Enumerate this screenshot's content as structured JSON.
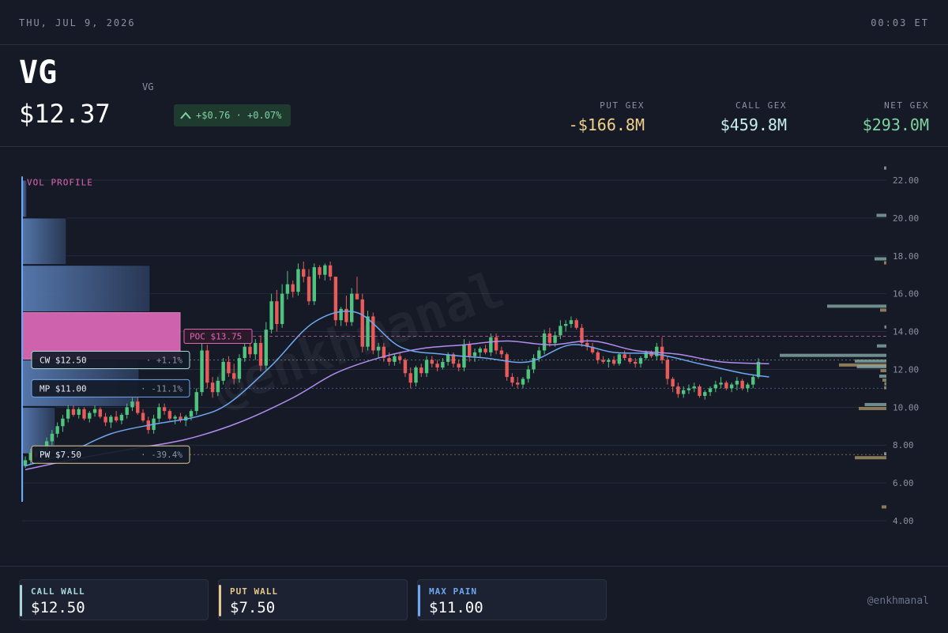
{
  "topbar": {
    "date": "THU, JUL 9, 2026",
    "time": "00:03 ET"
  },
  "header": {
    "ticker": "VG",
    "ticker_sub": "VG",
    "price": "$12.37",
    "change": "+$0.76 · +0.07%",
    "change_icon": "chevron-up-icon",
    "gex": [
      {
        "label": "PUT GEX",
        "value": "-$166.8M",
        "color": "#f0d08c"
      },
      {
        "label": "CALL GEX",
        "value": "$459.8M",
        "color": "#c8f0ee"
      },
      {
        "label": "NET GEX",
        "value": "$293.0M",
        "color": "#7fd3a0"
      }
    ]
  },
  "chart_data": {
    "type": "candlestick",
    "ylim": [
      4,
      22.8
    ],
    "yticks": [
      "22.00",
      "20.00",
      "18.00",
      "16.00",
      "14.00",
      "12.00",
      "10.00",
      "8.00",
      "6.00",
      "4.00"
    ],
    "watermark": "@enkhmanal",
    "vol_profile": {
      "label": "VOL PROFILE",
      "bins": [
        {
          "lo": 20.0,
          "hi": 22.0,
          "vol": 0.03
        },
        {
          "lo": 17.5,
          "hi": 20.0,
          "vol": 0.28
        },
        {
          "lo": 15.0,
          "hi": 17.5,
          "vol": 0.81
        },
        {
          "lo": 12.5,
          "hi": 15.0,
          "vol": 1.0
        },
        {
          "lo": 10.0,
          "hi": 12.5,
          "vol": 0.74
        },
        {
          "lo": 7.5,
          "hi": 10.0,
          "vol": 0.21
        },
        {
          "lo": 5.0,
          "hi": 7.5,
          "vol": 0.01
        }
      ]
    },
    "levels": [
      {
        "name": "POC",
        "label": "POC $13.75",
        "value": 13.75,
        "pct": "",
        "color": "#e066b4"
      },
      {
        "name": "CW",
        "label": "CW $12.50",
        "value": 12.5,
        "pct": "+1.1%",
        "color": "#a8d8d4"
      },
      {
        "name": "MP",
        "label": "MP $11.00",
        "value": 11.0,
        "pct": "-11.1%",
        "color": "#6ea8f0"
      },
      {
        "name": "PW",
        "label": "PW $7.50",
        "value": 7.5,
        "pct": "-39.4%",
        "color": "#e6c88c"
      }
    ],
    "candles": [
      [
        6.9,
        7.4,
        6.8,
        7.2
      ],
      [
        7.2,
        7.8,
        7.0,
        7.6
      ],
      [
        7.6,
        7.9,
        7.3,
        7.4
      ],
      [
        7.4,
        7.9,
        7.2,
        7.8
      ],
      [
        7.8,
        8.4,
        7.6,
        8.2
      ],
      [
        8.2,
        8.8,
        8.0,
        8.6
      ],
      [
        8.6,
        9.2,
        8.4,
        9.0
      ],
      [
        9.0,
        9.6,
        8.7,
        9.4
      ],
      [
        9.4,
        10.1,
        9.2,
        9.9
      ],
      [
        9.9,
        10.1,
        9.5,
        9.6
      ],
      [
        9.6,
        10.0,
        9.4,
        9.9
      ],
      [
        9.9,
        10.0,
        9.3,
        9.4
      ],
      [
        9.4,
        9.8,
        9.2,
        9.7
      ],
      [
        9.7,
        10.1,
        9.5,
        9.9
      ],
      [
        9.9,
        10.0,
        9.4,
        9.5
      ],
      [
        9.5,
        9.7,
        9.0,
        9.2
      ],
      [
        9.2,
        9.6,
        8.9,
        9.5
      ],
      [
        9.5,
        9.8,
        9.2,
        9.3
      ],
      [
        9.3,
        9.7,
        9.1,
        9.6
      ],
      [
        9.6,
        10.2,
        9.4,
        10.0
      ],
      [
        10.0,
        10.5,
        9.8,
        10.3
      ],
      [
        10.3,
        10.5,
        9.6,
        9.7
      ],
      [
        9.7,
        9.9,
        9.2,
        9.3
      ],
      [
        9.3,
        9.5,
        8.6,
        8.8
      ],
      [
        8.8,
        9.6,
        8.6,
        9.4
      ],
      [
        9.4,
        10.2,
        9.2,
        10.0
      ],
      [
        10.0,
        10.2,
        9.6,
        9.8
      ],
      [
        9.8,
        9.9,
        9.3,
        9.4
      ],
      [
        9.4,
        9.6,
        9.1,
        9.5
      ],
      [
        9.5,
        9.7,
        9.2,
        9.3
      ],
      [
        9.3,
        9.6,
        9.0,
        9.5
      ],
      [
        9.5,
        9.9,
        9.3,
        9.8
      ],
      [
        9.8,
        11.0,
        9.6,
        10.8
      ],
      [
        10.8,
        13.5,
        10.6,
        13.0
      ],
      [
        13.0,
        13.3,
        11.0,
        11.3
      ],
      [
        11.3,
        11.6,
        10.5,
        10.8
      ],
      [
        10.8,
        11.6,
        10.6,
        11.4
      ],
      [
        11.4,
        12.6,
        11.2,
        12.4
      ],
      [
        12.4,
        12.7,
        11.6,
        11.8
      ],
      [
        11.8,
        12.3,
        11.2,
        11.5
      ],
      [
        11.5,
        12.8,
        11.3,
        12.6
      ],
      [
        12.6,
        13.4,
        12.4,
        13.2
      ],
      [
        13.2,
        13.5,
        12.6,
        12.8
      ],
      [
        12.8,
        13.6,
        12.5,
        13.4
      ],
      [
        13.4,
        13.8,
        11.9,
        12.2
      ],
      [
        12.2,
        14.5,
        12.0,
        14.1
      ],
      [
        14.1,
        16.0,
        13.9,
        15.6
      ],
      [
        15.6,
        16.2,
        14.0,
        14.4
      ],
      [
        14.4,
        16.5,
        14.2,
        16.0
      ],
      [
        16.0,
        17.2,
        15.7,
        16.5
      ],
      [
        16.5,
        16.7,
        15.8,
        16.1
      ],
      [
        16.1,
        17.6,
        15.9,
        17.3
      ],
      [
        17.3,
        17.7,
        16.6,
        16.9
      ],
      [
        16.9,
        17.3,
        15.4,
        15.6
      ],
      [
        15.6,
        17.6,
        15.4,
        17.4
      ],
      [
        17.4,
        17.5,
        16.8,
        17.0
      ],
      [
        17.0,
        17.6,
        16.7,
        17.5
      ],
      [
        17.5,
        17.7,
        16.7,
        16.9
      ],
      [
        16.9,
        15.5,
        14.3,
        14.6
      ],
      [
        14.6,
        15.3,
        14.3,
        15.2
      ],
      [
        15.2,
        15.9,
        14.3,
        14.5
      ],
      [
        14.5,
        16.3,
        14.3,
        16.0
      ],
      [
        16.0,
        16.9,
        15.8,
        15.7
      ],
      [
        15.7,
        16.0,
        12.9,
        13.2
      ],
      [
        13.2,
        15.1,
        13.0,
        14.8
      ],
      [
        14.8,
        15.0,
        12.8,
        13.0
      ],
      [
        13.0,
        13.4,
        12.6,
        13.2
      ],
      [
        13.2,
        13.4,
        12.4,
        12.6
      ],
      [
        12.6,
        12.9,
        12.2,
        12.4
      ],
      [
        12.4,
        12.8,
        12.2,
        12.7
      ],
      [
        12.7,
        12.9,
        12.3,
        12.5
      ],
      [
        12.5,
        12.6,
        11.6,
        11.8
      ],
      [
        11.8,
        12.1,
        11.0,
        11.3
      ],
      [
        11.3,
        12.2,
        11.1,
        12.1
      ],
      [
        12.1,
        12.3,
        11.6,
        11.8
      ],
      [
        11.8,
        12.7,
        11.6,
        12.5
      ],
      [
        12.5,
        12.7,
        12.1,
        12.3
      ],
      [
        12.3,
        12.5,
        11.9,
        12.1
      ],
      [
        12.1,
        12.6,
        12.0,
        12.4
      ],
      [
        12.4,
        12.9,
        12.2,
        12.8
      ],
      [
        12.8,
        12.9,
        12.1,
        12.3
      ],
      [
        12.3,
        12.5,
        11.9,
        12.1
      ],
      [
        12.1,
        13.6,
        11.9,
        13.3
      ],
      [
        13.3,
        13.5,
        12.4,
        12.7
      ],
      [
        12.7,
        13.1,
        12.4,
        12.9
      ],
      [
        12.9,
        13.2,
        12.6,
        13.1
      ],
      [
        13.1,
        13.3,
        12.8,
        12.9
      ],
      [
        12.9,
        13.9,
        12.7,
        13.7
      ],
      [
        13.7,
        13.9,
        12.8,
        13.0
      ],
      [
        13.0,
        13.2,
        12.6,
        12.8
      ],
      [
        12.8,
        12.9,
        11.4,
        11.6
      ],
      [
        11.6,
        11.8,
        11.1,
        11.3
      ],
      [
        11.3,
        11.6,
        11.0,
        11.2
      ],
      [
        11.2,
        11.6,
        11.0,
        11.5
      ],
      [
        11.5,
        12.2,
        11.3,
        12.0
      ],
      [
        12.0,
        12.8,
        11.8,
        12.6
      ],
      [
        12.6,
        13.2,
        12.4,
        13.0
      ],
      [
        13.0,
        14.1,
        12.8,
        13.9
      ],
      [
        13.9,
        14.2,
        13.2,
        13.4
      ],
      [
        13.4,
        14.0,
        13.2,
        13.8
      ],
      [
        13.8,
        14.6,
        13.6,
        14.3
      ],
      [
        14.3,
        14.6,
        14.0,
        14.4
      ],
      [
        14.4,
        14.8,
        14.2,
        14.6
      ],
      [
        14.6,
        14.7,
        14.1,
        14.2
      ],
      [
        14.2,
        14.4,
        13.2,
        13.4
      ],
      [
        13.4,
        13.6,
        13.0,
        13.2
      ],
      [
        13.2,
        13.4,
        12.8,
        12.9
      ],
      [
        12.9,
        13.0,
        12.3,
        12.5
      ],
      [
        12.5,
        12.7,
        12.3,
        12.4
      ],
      [
        12.4,
        12.6,
        12.1,
        12.5
      ],
      [
        12.5,
        12.7,
        12.2,
        12.3
      ],
      [
        12.3,
        12.9,
        12.2,
        12.8
      ],
      [
        12.8,
        13.0,
        12.5,
        12.6
      ],
      [
        12.6,
        12.8,
        12.3,
        12.4
      ],
      [
        12.4,
        12.6,
        12.1,
        12.3
      ],
      [
        12.3,
        12.7,
        12.1,
        12.6
      ],
      [
        12.6,
        13.0,
        12.5,
        12.9
      ],
      [
        12.9,
        13.0,
        12.6,
        12.7
      ],
      [
        12.7,
        13.4,
        12.5,
        13.2
      ],
      [
        13.2,
        13.7,
        12.3,
        12.5
      ],
      [
        12.5,
        12.7,
        11.2,
        11.5
      ],
      [
        11.5,
        11.6,
        10.8,
        11.1
      ],
      [
        11.1,
        11.3,
        10.5,
        10.7
      ],
      [
        10.7,
        11.1,
        10.5,
        10.9
      ],
      [
        10.9,
        11.2,
        10.7,
        11.0
      ],
      [
        11.0,
        11.3,
        10.8,
        11.1
      ],
      [
        11.1,
        11.2,
        10.5,
        10.6
      ],
      [
        10.6,
        10.9,
        10.4,
        10.8
      ],
      [
        10.8,
        11.1,
        10.6,
        11.0
      ],
      [
        11.0,
        11.4,
        10.8,
        11.2
      ],
      [
        11.2,
        11.6,
        11.0,
        11.3
      ],
      [
        11.3,
        11.4,
        10.9,
        11.0
      ],
      [
        11.0,
        11.3,
        10.8,
        11.2
      ],
      [
        11.2,
        11.6,
        10.9,
        11.4
      ],
      [
        11.4,
        11.5,
        10.9,
        11.0
      ],
      [
        11.0,
        11.3,
        10.8,
        11.2
      ],
      [
        11.2,
        11.7,
        11.0,
        11.6
      ],
      [
        11.6,
        12.6,
        11.5,
        12.4
      ]
    ],
    "ma_fast": [
      [
        0,
        6.9
      ],
      [
        8,
        7.6
      ],
      [
        16,
        8.6
      ],
      [
        24,
        9.1
      ],
      [
        32,
        9.5
      ],
      [
        38,
        10.2
      ],
      [
        46,
        12.2
      ],
      [
        54,
        14.5
      ],
      [
        62,
        15.0
      ],
      [
        70,
        13.2
      ],
      [
        78,
        12.8
      ],
      [
        86,
        12.6
      ],
      [
        94,
        12.4
      ],
      [
        102,
        13.3
      ],
      [
        110,
        12.9
      ],
      [
        118,
        12.8
      ],
      [
        126,
        12.3
      ],
      [
        134,
        11.8
      ],
      [
        139,
        11.6
      ]
    ],
    "ma_slow": [
      [
        0,
        6.7
      ],
      [
        10,
        7.3
      ],
      [
        20,
        7.8
      ],
      [
        30,
        8.3
      ],
      [
        40,
        9.2
      ],
      [
        50,
        10.5
      ],
      [
        58,
        11.8
      ],
      [
        66,
        12.6
      ],
      [
        74,
        13.1
      ],
      [
        82,
        13.3
      ],
      [
        90,
        13.5
      ],
      [
        98,
        13.3
      ],
      [
        106,
        13.5
      ],
      [
        114,
        13.0
      ],
      [
        122,
        12.8
      ],
      [
        130,
        12.4
      ],
      [
        139,
        12.3
      ]
    ],
    "gex_bars": [
      {
        "price": 22.6,
        "call": 0.06,
        "put": 0
      },
      {
        "price": 20.1,
        "call": 0.25,
        "put": 0
      },
      {
        "price": 17.8,
        "call": 0.3,
        "put": 0.06
      },
      {
        "price": 15.3,
        "call": 1.5,
        "put": 0.16
      },
      {
        "price": 14.2,
        "call": 0.05,
        "put": 0
      },
      {
        "price": 13.2,
        "call": 0.24,
        "put": 0
      },
      {
        "price": 12.7,
        "call": 2.7,
        "put": 0
      },
      {
        "price": 12.4,
        "call": 0.8,
        "put": 1.2
      },
      {
        "price": 12.1,
        "call": 0.75,
        "put": 0.15
      },
      {
        "price": 11.6,
        "call": 0.18,
        "put": 0.1
      },
      {
        "price": 11.2,
        "call": 0.05,
        "put": 0.06
      },
      {
        "price": 10.1,
        "call": 0.55,
        "put": 0.7
      },
      {
        "price": 7.5,
        "call": 0.06,
        "put": 0.8
      },
      {
        "price": 4.9,
        "call": 0,
        "put": 0.12
      }
    ]
  },
  "footer": {
    "cards": [
      {
        "label": "CALL WALL",
        "value": "$12.50",
        "color": "#a8d8d4"
      },
      {
        "label": "PUT WALL",
        "value": "$7.50",
        "color": "#e6c88c"
      },
      {
        "label": "MAX PAIN",
        "value": "$11.00",
        "color": "#6ea8f0"
      }
    ],
    "credit": "@enkhmanal"
  }
}
